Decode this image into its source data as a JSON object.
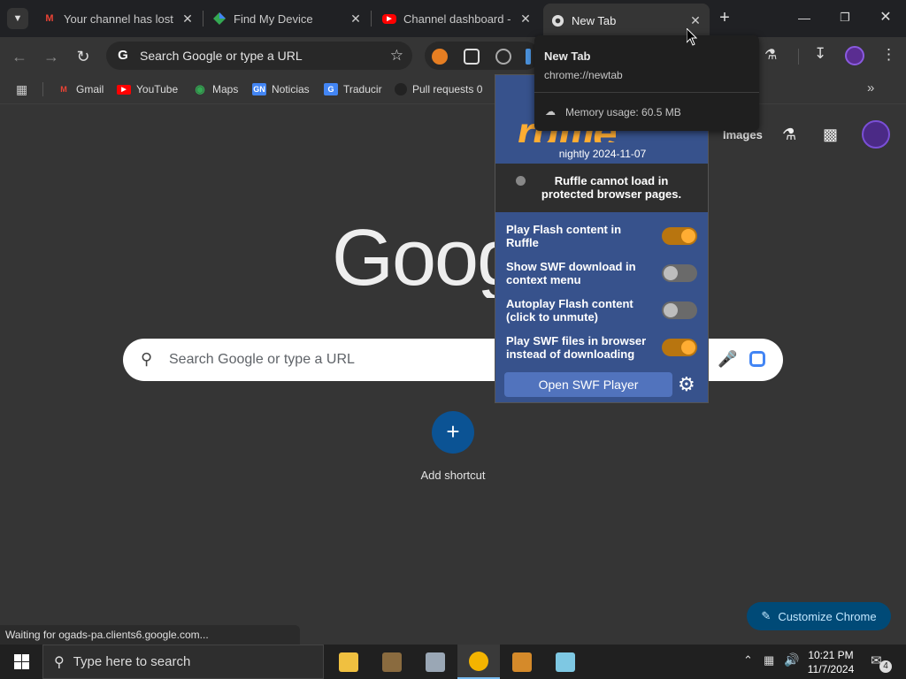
{
  "tabs": [
    {
      "title": "Your channel has lost a",
      "icon": "gmail-icon"
    },
    {
      "title": "Find My Device",
      "icon": "find-my-device-icon"
    },
    {
      "title": "Channel dashboard - Y",
      "icon": "youtube-icon"
    },
    {
      "title": "New Tab",
      "icon": "chrome-icon",
      "active": true
    }
  ],
  "omnibox": {
    "text": "Search Google or type a URL"
  },
  "bookmarks": [
    {
      "label": "Gmail"
    },
    {
      "label": "YouTube"
    },
    {
      "label": "Maps"
    },
    {
      "label": "Noticias"
    },
    {
      "label": "Traducir"
    },
    {
      "label": "Pull requests 0"
    }
  ],
  "tooltip": {
    "title": "New Tab",
    "url": "chrome://newtab",
    "memory": "Memory usage: 60.5 MB"
  },
  "ruffle": {
    "logo": "ruffle",
    "version": "nightly 2024-11-07",
    "status": "Ruffle cannot load in protected browser pages.",
    "options": [
      {
        "label": "Play Flash content in Ruffle",
        "enabled": true
      },
      {
        "label": "Show SWF download in context menu",
        "enabled": false
      },
      {
        "label": "Autoplay Flash content (click to unmute)",
        "enabled": false
      },
      {
        "label": "Play SWF files in browser instead of downloading",
        "enabled": true
      }
    ],
    "open_button": "Open SWF Player"
  },
  "page": {
    "logo": "Google",
    "images_link": "Images",
    "search_placeholder": "Search Google or type a URL",
    "add_shortcut": "Add shortcut",
    "customize": "Customize Chrome"
  },
  "status_bar": "Waiting for ogads-pa.clients6.google.com...",
  "taskbar": {
    "search_placeholder": "Type here to search",
    "time": "10:21 PM",
    "date": "11/7/2024",
    "notification_count": "4"
  },
  "colors": {
    "accent_blue": "#0b5394",
    "ruffle_blue": "#37528c",
    "ruffle_orange": "#ffad33"
  }
}
